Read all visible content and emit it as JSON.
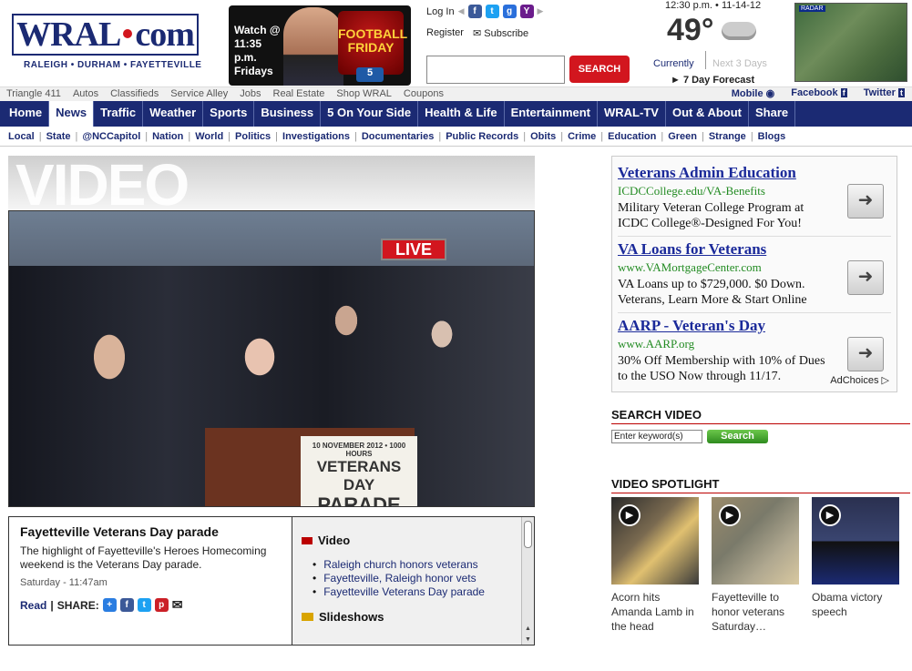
{
  "header": {
    "logo_text": "WRAL",
    "logo_suffix": "com",
    "logo_sub": "RALEIGH • DURHAM • FAYETTEVILLE",
    "promo_watch": "Watch @ 11:35 p.m. Fridays",
    "promo_show": "FOOTBALL FRIDAY",
    "promo_channel": "5",
    "login": "Log In",
    "register": "Register",
    "subscribe": "Subscribe",
    "search_button": "SEARCH",
    "search_value": ""
  },
  "weather": {
    "time": "12:30 p.m. • 11-14-12",
    "temp": "49°",
    "currently": "Currently",
    "next3": "Next 3 Days",
    "forecast": "► 7 Day Forecast",
    "radar_label": "RADAR"
  },
  "utilbar": {
    "items": [
      "Triangle 411",
      "Autos",
      "Classifieds",
      "Service Alley",
      "Jobs",
      "Real Estate",
      "Shop WRAL",
      "Coupons"
    ],
    "mobile": "Mobile",
    "facebook": "Facebook",
    "twitter": "Twitter"
  },
  "nav": {
    "items": [
      "Home",
      "News",
      "Traffic",
      "Weather",
      "Sports",
      "Business",
      "5 On Your Side",
      "Health & Life",
      "Entertainment",
      "WRAL-TV",
      "Out & About",
      "Share"
    ],
    "active_index": 1
  },
  "subnav": {
    "items": [
      "Local",
      "State",
      "@NCCapitol",
      "Nation",
      "World",
      "Politics",
      "Investigations",
      "Documentaries",
      "Public Records",
      "Obits",
      "Crime",
      "Education",
      "Green",
      "Strange",
      "Blogs"
    ]
  },
  "video": {
    "header_word": "VIDEO",
    "live_badge": "LIVE",
    "sign_line1": "10 NOVEMBER 2012 • 1000 HOURS",
    "sign_line2": "VETERANS DAY",
    "sign_line3": "PARADE",
    "title": "Fayetteville Veterans Day parade",
    "description": "The highlight of Fayetteville's Heroes Homecoming weekend is the Veterans Day parade.",
    "date": "Saturday - 11:47am",
    "read": "Read",
    "share_label": "SHARE:",
    "related_video_label": "Video",
    "related_videos": [
      "Raleigh church honors veterans",
      "Fayetteville, Raleigh honor vets",
      "Fayetteville Veterans Day parade"
    ],
    "slideshows_label": "Slideshows"
  },
  "ads": [
    {
      "title": "Veterans Admin Education",
      "url": "ICDCCollege.edu/VA-Benefits",
      "desc": "Military Veteran College Program at ICDC College®-Designed For You!"
    },
    {
      "title": "VA Loans for Veterans",
      "url": "www.VAMortgageCenter.com",
      "desc": "VA Loans up to $729,000. $0 Down. Veterans, Learn More & Start Online"
    },
    {
      "title": "AARP - Veteran's Day",
      "url": "www.AARP.org",
      "desc": "30% Off Membership with 10% of Dues to the USO Now through 11/17."
    }
  ],
  "adchoices": "AdChoices",
  "search_video": {
    "title": "SEARCH VIDEO",
    "placeholder": "Enter keyword(s)",
    "button": "Search"
  },
  "spotlight": {
    "title": "VIDEO SPOTLIGHT",
    "items": [
      {
        "caption": "Acorn hits Amanda Lamb in the head"
      },
      {
        "caption": "Fayetteville to honor veterans Saturday…"
      },
      {
        "caption": "Obama victory speech"
      }
    ]
  },
  "colors": {
    "brand_navy": "#1b2a73",
    "brand_red": "#d2161e",
    "ad_link": "#1b2a9a",
    "ad_url": "#228b22"
  }
}
